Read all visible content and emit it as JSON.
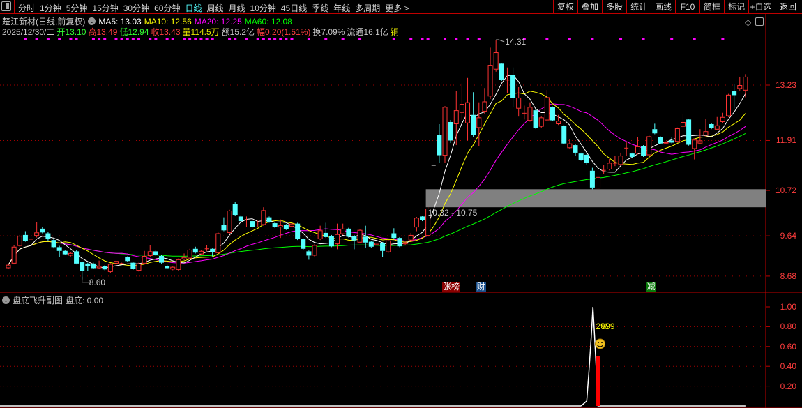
{
  "toolbar": {
    "nav": [
      "分时",
      "1分钟",
      "5分钟",
      "15分钟",
      "30分钟",
      "60分钟",
      "日线",
      "周线",
      "月线",
      "10分钟",
      "45日线",
      "季线",
      "年线",
      "多周期",
      "更多 >"
    ],
    "active": "日线",
    "buttons": [
      "复权",
      "叠加",
      "多股",
      "统计",
      "画线",
      "F10",
      "简框",
      "标记",
      "+自选",
      "返回"
    ]
  },
  "header": {
    "title": "楚江新材(日线,前复权)",
    "ma": [
      {
        "text": "MA5: 13.03",
        "color": "#ffffff"
      },
      {
        "text": "MA10: 12.56",
        "color": "#ffff00"
      },
      {
        "text": "MA20: 12.25",
        "color": "#ff00ff"
      },
      {
        "text": "MA60: 12.08",
        "color": "#00ff00"
      }
    ],
    "quote": [
      {
        "text": "2025/12/30/二",
        "color": "#c8c8c8"
      },
      {
        "text": "开13.10",
        "color": "#33ff33"
      },
      {
        "text": "高13.49",
        "color": "#ff4040"
      },
      {
        "text": "低12.94",
        "color": "#33ff33"
      },
      {
        "text": "收13.43",
        "color": "#ff4040"
      },
      {
        "text": "量114.5万",
        "color": "#e6e600"
      },
      {
        "text": "额15.2亿",
        "color": "#c8c8c8"
      },
      {
        "text": "幅0.20(1.51%)",
        "color": "#ff4040"
      },
      {
        "text": "换7.09%",
        "color": "#c8c8c8"
      },
      {
        "text": "流通16.1亿",
        "color": "#c8c8c8"
      },
      {
        "text": "铜",
        "color": "#e6e600"
      }
    ]
  },
  "colors": {
    "up": "#ff3333",
    "down": "#54ffff",
    "grid": "#a00000",
    "axis": "#c00000",
    "ma5": "#ffffff",
    "ma10": "#ffff00",
    "ma20": "#ff00ff",
    "ma60": "#00ff00",
    "dot": "#ff00ff"
  },
  "chart_data": {
    "type": "candlestick",
    "y_ticks": [
      "13.23",
      "11.91",
      "10.72",
      "9.64",
      "8.68"
    ],
    "y_tick_values": [
      13.23,
      11.91,
      10.72,
      9.64,
      8.68
    ],
    "high_label": "14.31",
    "low_label": "8.60",
    "high_index": 86,
    "low_index": 13,
    "zone": {
      "low": 10.32,
      "high": 10.75,
      "label": "10.32 - 10.75",
      "start_index": 74
    },
    "events": [
      {
        "text": "张榜",
        "index": 77,
        "color": "#8b0000"
      },
      {
        "text": "财",
        "index": 83,
        "color": "#1a4f8a"
      },
      {
        "text": "减",
        "index": 113,
        "color": "#0a7a0a"
      }
    ],
    "signal_dots": [
      3,
      5,
      7,
      9,
      11,
      12,
      15,
      16,
      17,
      19,
      20,
      21,
      22,
      23,
      25,
      26,
      28,
      29,
      31,
      32,
      33,
      34,
      35,
      36,
      39,
      40,
      42,
      44,
      45,
      46,
      47,
      48,
      49,
      50,
      53,
      56,
      59,
      62,
      68,
      71,
      73,
      74,
      77,
      79,
      81,
      83,
      91,
      95,
      99,
      103,
      108,
      112,
      117,
      121,
      126
    ],
    "ohlc": [
      [
        8.87,
        8.98,
        8.85,
        8.95
      ],
      [
        8.98,
        9.42,
        8.96,
        9.38
      ],
      [
        9.4,
        9.66,
        9.38,
        9.64
      ],
      [
        9.66,
        9.75,
        9.5,
        9.52
      ],
      [
        9.56,
        9.6,
        9.5,
        9.56
      ],
      [
        9.64,
        9.97,
        9.6,
        9.72
      ],
      [
        9.81,
        9.84,
        9.7,
        9.72
      ],
      [
        9.7,
        9.74,
        9.52,
        9.56
      ],
      [
        9.54,
        9.56,
        9.34,
        9.37
      ],
      [
        9.37,
        9.4,
        9.14,
        9.28
      ],
      [
        9.28,
        9.3,
        9.18,
        9.2
      ],
      [
        9.17,
        9.25,
        9.15,
        9.23
      ],
      [
        9.27,
        9.29,
        8.96,
        8.98
      ],
      [
        9.01,
        9.03,
        8.6,
        8.81
      ],
      [
        8.98,
        9.0,
        8.8,
        8.92
      ],
      [
        8.98,
        9.0,
        8.85,
        8.87
      ],
      [
        8.87,
        9.05,
        8.85,
        8.92
      ],
      [
        8.92,
        8.94,
        8.82,
        8.84
      ],
      [
        8.78,
        8.99,
        8.76,
        8.97
      ],
      [
        8.98,
        9.06,
        8.96,
        9.04
      ],
      [
        8.98,
        9.0,
        8.96,
        8.98
      ],
      [
        9.13,
        9.15,
        9.02,
        9.04
      ],
      [
        9.0,
        9.02,
        8.83,
        8.85
      ],
      [
        8.81,
        9.0,
        8.79,
        8.98
      ],
      [
        8.98,
        9.28,
        8.96,
        9.16
      ],
      [
        9.16,
        9.42,
        9.14,
        9.27
      ],
      [
        9.27,
        9.3,
        9.16,
        9.18
      ],
      [
        9.16,
        9.18,
        8.98,
        9.0
      ],
      [
        8.92,
        8.95,
        8.85,
        8.87
      ],
      [
        8.84,
        8.92,
        8.82,
        8.9
      ],
      [
        8.83,
        9.1,
        8.81,
        9.08
      ],
      [
        9.08,
        9.22,
        9.06,
        9.13
      ],
      [
        9.1,
        9.33,
        9.08,
        9.31
      ],
      [
        9.33,
        9.38,
        9.22,
        9.24
      ],
      [
        9.2,
        9.3,
        9.18,
        9.28
      ],
      [
        9.33,
        9.42,
        9.28,
        9.33
      ],
      [
        9.33,
        9.35,
        9.15,
        9.25
      ],
      [
        9.23,
        9.72,
        9.21,
        9.7
      ],
      [
        9.9,
        10.08,
        9.75,
        9.77
      ],
      [
        9.71,
        10.26,
        9.69,
        10.24
      ],
      [
        10.39,
        10.45,
        10.12,
        10.14
      ],
      [
        10.1,
        10.13,
        9.97,
        9.99
      ],
      [
        10.02,
        10.1,
        9.85,
        10.02
      ],
      [
        9.99,
        10.0,
        9.83,
        9.85
      ],
      [
        9.9,
        10.0,
        9.85,
        9.9
      ],
      [
        9.9,
        10.32,
        9.88,
        10.25
      ],
      [
        10.08,
        10.1,
        9.95,
        9.97
      ],
      [
        9.94,
        9.96,
        9.83,
        9.85
      ],
      [
        9.84,
        10.03,
        9.59,
        9.89
      ],
      [
        9.9,
        9.92,
        9.78,
        9.8
      ],
      [
        9.86,
        9.95,
        9.84,
        9.93
      ],
      [
        9.93,
        9.95,
        9.54,
        9.56
      ],
      [
        9.56,
        9.58,
        9.31,
        9.33
      ],
      [
        9.27,
        9.29,
        9.07,
        9.17
      ],
      [
        9.17,
        9.44,
        9.15,
        9.42
      ],
      [
        9.56,
        9.88,
        9.54,
        9.77
      ],
      [
        9.71,
        9.95,
        9.59,
        9.61
      ],
      [
        9.64,
        9.66,
        9.37,
        9.39
      ],
      [
        9.44,
        9.93,
        9.32,
        9.68
      ],
      [
        9.68,
        9.93,
        9.66,
        9.81
      ],
      [
        9.81,
        9.83,
        9.6,
        9.62
      ],
      [
        9.64,
        9.66,
        9.32,
        9.53
      ],
      [
        9.48,
        9.8,
        9.46,
        9.78
      ],
      [
        9.62,
        9.88,
        9.36,
        9.48
      ],
      [
        9.5,
        9.52,
        9.36,
        9.38
      ],
      [
        9.42,
        9.49,
        9.4,
        9.47
      ],
      [
        9.47,
        9.49,
        9.13,
        9.28
      ],
      [
        9.25,
        9.55,
        9.23,
        9.53
      ],
      [
        9.7,
        9.82,
        9.57,
        9.59
      ],
      [
        9.59,
        9.61,
        9.37,
        9.39
      ],
      [
        9.44,
        9.5,
        9.42,
        9.48
      ],
      [
        9.53,
        9.71,
        9.51,
        9.66
      ],
      [
        9.84,
        10.09,
        9.75,
        10.07
      ],
      [
        10.1,
        10.12,
        9.99,
        10.01
      ],
      [
        9.64,
        10.35,
        9.62,
        10.29
      ],
      [
        11.32,
        11.32,
        11.32,
        11.32
      ],
      [
        12.05,
        12.3,
        11.38,
        11.56
      ],
      [
        11.55,
        12.73,
        11.38,
        12.71
      ],
      [
        12.35,
        12.4,
        11.85,
        11.91
      ],
      [
        12.3,
        13.09,
        11.8,
        12.63
      ],
      [
        12.57,
        13.27,
        12.4,
        12.78
      ],
      [
        12.32,
        13.4,
        11.91,
        12.82
      ],
      [
        12.52,
        13.06,
        12.0,
        12.04
      ],
      [
        12.21,
        12.82,
        11.78,
        12.46
      ],
      [
        12.6,
        13.16,
        12.55,
        12.84
      ],
      [
        12.96,
        14.12,
        12.9,
        13.71
      ],
      [
        13.6,
        14.31,
        13.55,
        14.01
      ],
      [
        13.74,
        13.76,
        13.33,
        13.35
      ],
      [
        13.35,
        13.65,
        13.04,
        13.35
      ],
      [
        13.47,
        13.65,
        12.71,
        12.92
      ],
      [
        12.67,
        13.18,
        12.48,
        12.93
      ],
      [
        12.56,
        12.74,
        12.41,
        12.56
      ],
      [
        12.38,
        12.82,
        12.36,
        12.71
      ],
      [
        12.63,
        12.66,
        12.19,
        12.21
      ],
      [
        12.24,
        12.48,
        12.2,
        12.46
      ],
      [
        12.39,
        13.11,
        12.37,
        12.94
      ],
      [
        12.7,
        12.72,
        12.37,
        12.39
      ],
      [
        12.3,
        12.52,
        12.28,
        12.38
      ],
      [
        12.25,
        12.27,
        11.82,
        11.84
      ],
      [
        11.73,
        11.95,
        11.71,
        11.84
      ],
      [
        11.8,
        11.82,
        11.55,
        11.62
      ],
      [
        11.6,
        11.62,
        11.43,
        11.45
      ],
      [
        11.57,
        11.59,
        11.34,
        11.37
      ],
      [
        11.19,
        11.26,
        10.75,
        10.79
      ],
      [
        10.77,
        11.1,
        10.75,
        11.04
      ],
      [
        11.2,
        11.33,
        11.11,
        11.2
      ],
      [
        11.22,
        11.47,
        11.2,
        11.38
      ],
      [
        11.37,
        11.55,
        11.3,
        11.37
      ],
      [
        11.33,
        11.62,
        11.31,
        11.55
      ],
      [
        11.73,
        11.87,
        11.55,
        11.73
      ],
      [
        11.6,
        11.62,
        11.5,
        11.52
      ],
      [
        11.6,
        12.0,
        11.58,
        11.77
      ],
      [
        11.77,
        11.8,
        11.52,
        11.54
      ],
      [
        11.56,
        12.03,
        11.54,
        12.01
      ],
      [
        12.18,
        12.31,
        12.06,
        12.08
      ],
      [
        11.99,
        12.01,
        11.82,
        11.84
      ],
      [
        11.84,
        11.89,
        11.82,
        11.87
      ],
      [
        11.91,
        11.99,
        11.84,
        11.86
      ],
      [
        11.88,
        12.22,
        11.86,
        12.2
      ],
      [
        12.24,
        12.54,
        12.22,
        12.35
      ],
      [
        12.41,
        12.43,
        11.79,
        11.81
      ],
      [
        11.71,
        11.95,
        11.46,
        11.93
      ],
      [
        11.84,
        12.18,
        11.82,
        11.91
      ],
      [
        12.03,
        12.42,
        12.01,
        12.13
      ],
      [
        12.3,
        12.32,
        12.18,
        12.2
      ],
      [
        12.17,
        12.47,
        12.15,
        12.27
      ],
      [
        12.35,
        12.57,
        12.33,
        12.47
      ],
      [
        12.49,
        13.02,
        12.47,
        13.0
      ],
      [
        13.08,
        13.26,
        12.67,
        12.99
      ],
      [
        13.14,
        13.43,
        13.1,
        13.23
      ],
      [
        13.1,
        13.49,
        12.94,
        13.43
      ]
    ]
  },
  "sub_panel": {
    "title": "盘底飞升副图",
    "value_label": "盘底: 0.00",
    "y_ticks": [
      "1.00",
      "0.80",
      "0.60",
      "0.40",
      "0.20"
    ],
    "y_tick_values": [
      1.0,
      0.8,
      0.6,
      0.4,
      0.2
    ],
    "line": [
      [
        101,
        0
      ],
      [
        102,
        0.05
      ],
      [
        102.4,
        0.35
      ],
      [
        102.8,
        0.7
      ],
      [
        103.1,
        1.0
      ],
      [
        103.4,
        0.7
      ],
      [
        103.7,
        0.35
      ],
      [
        104,
        0
      ]
    ],
    "bar": {
      "index": 104,
      "value": 0.5
    },
    "signal_text_a": "2%",
    "signal_text_b": "899",
    "line_end_index": 130
  }
}
